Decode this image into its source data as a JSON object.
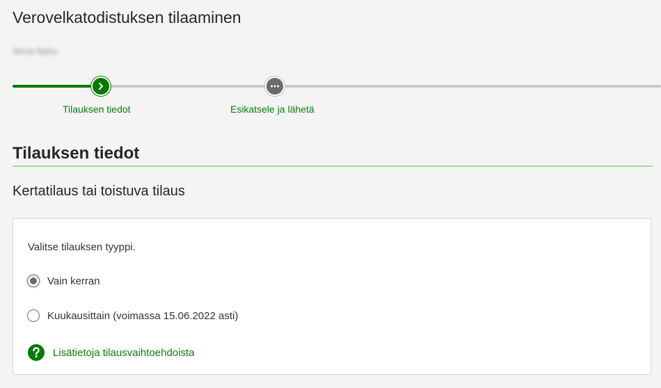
{
  "header": {
    "title": "Verovelkatodistuksen tilaaminen",
    "subtitle_blurred": "Anna Nahu"
  },
  "stepper": {
    "steps": [
      {
        "label": "Tilauksen tiedot",
        "status": "current",
        "icon": "chevron-right-icon"
      },
      {
        "label": "Esikatsele ja lähetä",
        "status": "upcoming",
        "icon": "ellipsis-icon"
      }
    ],
    "progress_fraction": 0.14
  },
  "section": {
    "title": "Tilauksen tiedot",
    "subtitle": "Kertatilaus tai toistuva tilaus"
  },
  "order_type": {
    "prompt": "Valitse tilauksen tyyppi.",
    "options": [
      {
        "label": "Vain kerran",
        "selected": true
      },
      {
        "label": "Kuukausittain (voimassa 15.06.2022 asti)",
        "selected": false
      }
    ],
    "info_link": "Lisätietoja tilausvaihtoehdoista"
  },
  "colors": {
    "accent_green": "#007a00",
    "link_green": "#0a7d0a",
    "track_gray": "#c9c9c9",
    "background": "#f4f4f4"
  }
}
